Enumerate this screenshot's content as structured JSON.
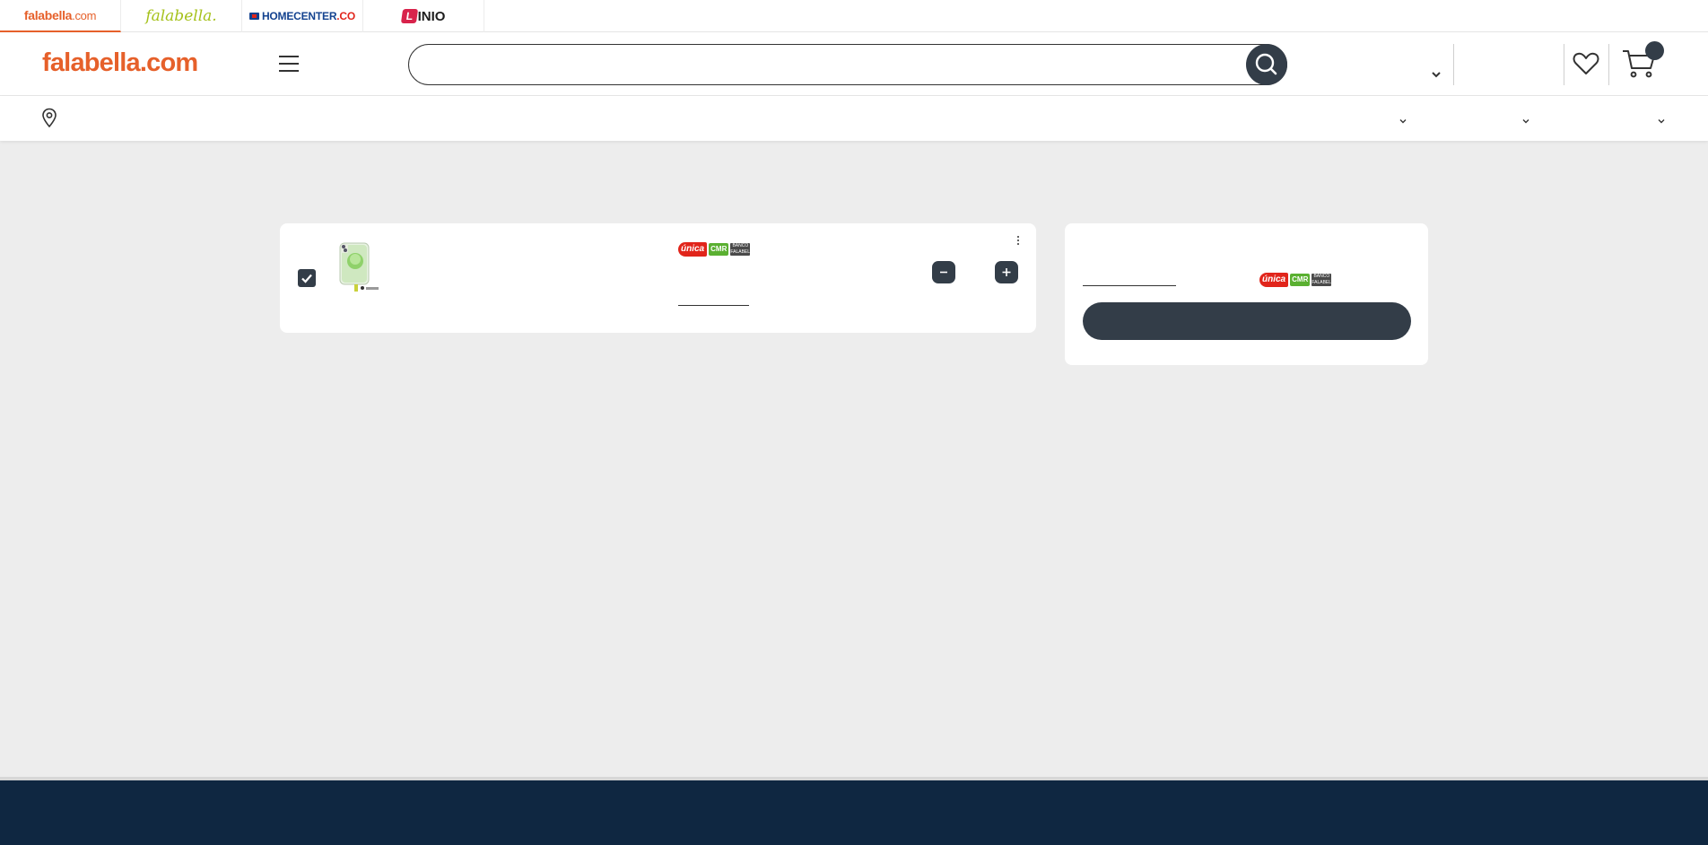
{
  "brand_strip": {
    "tabs": [
      {
        "main": "falabella",
        "suffix": ".com"
      },
      {
        "main": "falabella."
      },
      {
        "main": "HOMECENTER",
        "suffix": ".CO"
      },
      {
        "main": "INIO",
        "mark": "L"
      }
    ]
  },
  "header": {
    "logo": {
      "main": "falabella",
      "suffix": ".com"
    },
    "search": {
      "value": "",
      "placeholder": ""
    }
  },
  "cart_item": {
    "checked": true,
    "badges": {
      "unica": "única",
      "cmr": "CMR",
      "other": "BANCO FALABELLA"
    }
  },
  "summary": {
    "badges": {
      "unica": "única",
      "cmr": "CMR",
      "other": "BANCO FALABELLA"
    }
  },
  "colors": {
    "brand_orange": "#e6602a",
    "dark": "#333d48",
    "footer": "#0f2741",
    "background": "#ededed"
  }
}
